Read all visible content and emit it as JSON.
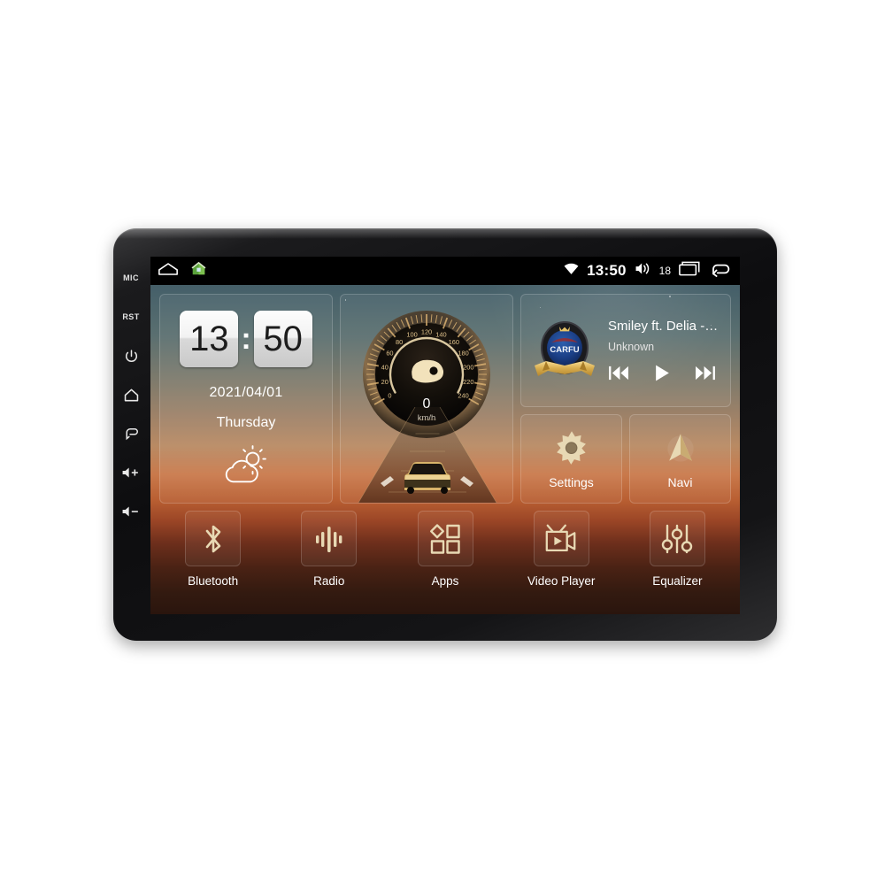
{
  "device": {
    "type": "android-car-head-unit",
    "bezel_buttons": [
      {
        "name": "mic",
        "label": "MIC",
        "kind": "text"
      },
      {
        "name": "reset",
        "label": "RST",
        "kind": "text"
      },
      {
        "name": "power",
        "label": "",
        "kind": "icon"
      },
      {
        "name": "home",
        "label": "",
        "kind": "icon"
      },
      {
        "name": "back",
        "label": "",
        "kind": "icon"
      },
      {
        "name": "volume-up",
        "label": "+",
        "kind": "icon"
      },
      {
        "name": "volume-down",
        "label": "-",
        "kind": "icon"
      }
    ]
  },
  "statusbar": {
    "left_icons": [
      "home-outline-icon",
      "green-house-icon"
    ],
    "wifi_icon": "wifi-icon",
    "clock": "13:50",
    "volume_icon": "volume-icon",
    "volume_level": "18",
    "recents_icon": "recents-icon",
    "back_icon": "back-arrow-icon"
  },
  "clock_widget": {
    "hours": "13",
    "minutes": "50",
    "separator": ":",
    "date": "2021/04/01",
    "weekday": "Thursday",
    "weather_icon": "partly-cloudy-icon"
  },
  "speedometer": {
    "value": "0",
    "unit": "km/h",
    "ticks": [
      "0",
      "20",
      "40",
      "60",
      "80",
      "100",
      "120",
      "140",
      "160",
      "180",
      "200",
      "220",
      "240"
    ],
    "max": 240,
    "dial_color": "#d9b071"
  },
  "music": {
    "album_art": "carfu-badge-logo",
    "album_art_text": "CARFU",
    "title": "Smiley ft. Delia - Ne v...",
    "artist": "Unknown",
    "controls": [
      {
        "name": "previous-track",
        "icon": "skip-previous-icon"
      },
      {
        "name": "play",
        "icon": "play-icon"
      },
      {
        "name": "next-track",
        "icon": "skip-next-icon"
      }
    ]
  },
  "tiles": [
    {
      "name": "settings",
      "label": "Settings",
      "icon": "gear-icon"
    },
    {
      "name": "navi",
      "label": "Navi",
      "icon": "navigation-arrow-icon"
    }
  ],
  "dock": [
    {
      "name": "bluetooth",
      "label": "Bluetooth",
      "icon": "bluetooth-icon"
    },
    {
      "name": "radio",
      "label": "Radio",
      "icon": "radio-waveform-icon"
    },
    {
      "name": "apps",
      "label": "Apps",
      "icon": "apps-grid-icon"
    },
    {
      "name": "video-player",
      "label": "Video Player",
      "icon": "video-player-icon"
    },
    {
      "name": "equalizer",
      "label": "Equalizer",
      "icon": "equalizer-sliders-icon"
    }
  ],
  "colors": {
    "accent_gold": "#e8d9b4",
    "dial_gold": "#d9b071",
    "statusbar_bg": "#000000",
    "text_primary": "#ffffff"
  }
}
